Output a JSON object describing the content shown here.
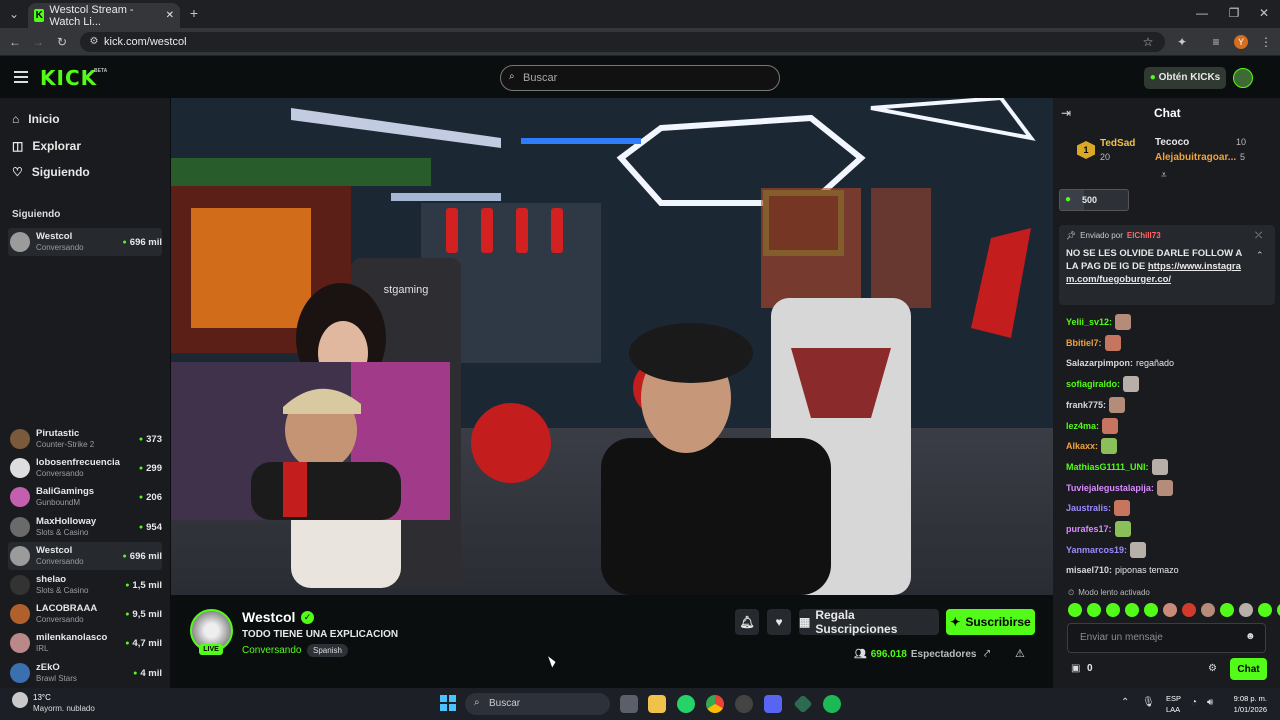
{
  "browser": {
    "tab_title": "Westcol Stream - Watch Li...",
    "url": "kick.com/westcol",
    "new_tab": "+",
    "profile_initial": "Y"
  },
  "header": {
    "logo": "KICK",
    "logo_badge": "BETA",
    "search_placeholder": "Buscar",
    "get_kicks": "Obtén KICKs"
  },
  "sidebar": {
    "nav": [
      {
        "label": "Inicio",
        "icon": "home-icon"
      },
      {
        "label": "Explorar",
        "icon": "compass-icon"
      },
      {
        "label": "Siguiendo",
        "icon": "heart-icon"
      }
    ],
    "following_title": "Siguiendo",
    "top_channel": {
      "name": "Westcol",
      "category": "Conversando",
      "viewers": "696 mil"
    },
    "channels": [
      {
        "name": "Pirutastic",
        "category": "Counter-Strike 2",
        "viewers": "373",
        "color": "#7a5a3a"
      },
      {
        "name": "lobosenfrecuencia",
        "category": "Conversando",
        "viewers": "299",
        "color": "#ddd"
      },
      {
        "name": "BaliGamings",
        "category": "GunboundM",
        "viewers": "206",
        "color": "#c45fb0"
      },
      {
        "name": "MaxHolloway",
        "category": "Slots & Casino",
        "viewers": "954",
        "color": "#6a6a6a"
      },
      {
        "name": "Westcol",
        "category": "Conversando",
        "viewers": "696 mil",
        "color": "#9b9b9b"
      },
      {
        "name": "shelao",
        "category": "Slots & Casino",
        "viewers": "1,5 mil",
        "color": "#333"
      },
      {
        "name": "LACOBRAAA",
        "category": "Conversando",
        "viewers": "9,5 mil",
        "color": "#b0602a"
      },
      {
        "name": "milenkanolasco",
        "category": "IRL",
        "viewers": "4,7 mil",
        "color": "#b88"
      },
      {
        "name": "zEkO",
        "category": "Brawl Stars",
        "viewers": "4 mil",
        "color": "#3a6fb0"
      }
    ]
  },
  "video": {
    "chair_brand": "stgaming"
  },
  "stream": {
    "channel": "Westcol",
    "title": "TODO TIENE UNA EXPLICACION",
    "category": "Conversando",
    "language": "Spanish",
    "live": "LIVE",
    "gift_subs": "Regala Suscripciones",
    "subscribe": "Suscribirse",
    "viewers_count": "696.018",
    "viewers_label": "Espectadores"
  },
  "chat": {
    "title": "Chat",
    "leaderboard": [
      {
        "rank": "1",
        "name": "TedSad",
        "value": "20"
      },
      {
        "name": "Tecoco",
        "value": "10"
      },
      {
        "name": "Alejabuitragoar...",
        "value": "5"
      }
    ],
    "kicks_value": "500",
    "pinned": {
      "sent_by": "Enviado por",
      "sender": "ElChill73",
      "text": "NO SE LES OLVIDE DARLE FOLLOW A LA PAG DE IG DE",
      "link": "https://www.instagram.com/fuegoburger.co/"
    },
    "messages": [
      {
        "user": "Yelii_sv12:",
        "text": "",
        "color": "#53fc18"
      },
      {
        "user": "Bbitiel7:",
        "text": "",
        "color": "#f1a33a"
      },
      {
        "user": "Salazarpimpon:",
        "text": "regañado",
        "color": "#d8d8d8"
      },
      {
        "user": "sofiagiraldo:",
        "text": "",
        "color": "#53fc18"
      },
      {
        "user": "frank775:",
        "text": "",
        "color": "#d8d8d8"
      },
      {
        "user": "lez4ma:",
        "text": "",
        "color": "#53fc18"
      },
      {
        "user": "Alkaxx:",
        "text": "",
        "color": "#f1a33a"
      },
      {
        "user": "MathiasG1111_UNI:",
        "text": "",
        "color": "#53fc18"
      },
      {
        "user": "Tuviejalegustalapija:",
        "text": "",
        "color": "#d98bff"
      },
      {
        "user": "Jaustralis:",
        "text": "",
        "color": "#9a8cff"
      },
      {
        "user": "purafes17:",
        "text": "",
        "color": "#d98bff"
      },
      {
        "user": "Yanmarcos19:",
        "text": "",
        "color": "#9a8cff"
      },
      {
        "user": "misael710:",
        "text": "piponas temazo",
        "color": "#d8d8d8"
      }
    ],
    "slow_mode": "Modo lento activado",
    "input_placeholder": "Enviar un mensaje",
    "points": "0",
    "send_button": "Chat"
  },
  "taskbar": {
    "weather_temp": "13°C",
    "weather_desc": "Mayorm. nublado",
    "search": "Buscar",
    "lang_top": "ESP",
    "lang_bottom": "LAA",
    "time": "9:08 p. m.",
    "date": "1/01/2026"
  }
}
